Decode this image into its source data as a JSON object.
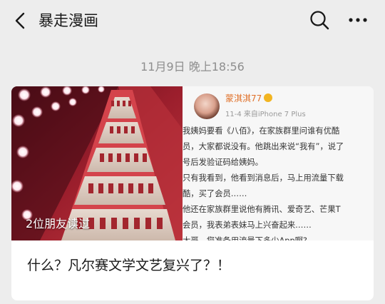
{
  "header": {
    "back_icon": "chevron-left-icon",
    "title": "暴走漫画",
    "search_icon": "search-icon",
    "more_icon": "more-horizontal-icon"
  },
  "timestamp": "11月9日 晚上18:56",
  "article": {
    "friends_read": "2位朋友读过",
    "title": "什么？凡尔赛文学文艺复兴了？！",
    "thumbnail": {
      "left_image": "lipstick-display-counter-photo",
      "post": {
        "username": "蒙淇淇77",
        "meta": "11-4 来自iPhone 7 Plus",
        "lines": [
          "我姨妈要看《八佰》，在家族群里问谁有优酷",
          "员，大家都说没有。他跳出来说“我有”，说了",
          "号后发验证码给姨妈。",
          "只有我看到，他看到消息后，马上用流量下载",
          "酷，买了会员……",
          "他还在家族群里说他有腾讯、爱奇艺、芒果T",
          "会员，我表弟表妹马上兴奋起来……",
          "大哥，您准备用流量下多少App啊?"
        ]
      }
    }
  },
  "colors": {
    "background": "#ededed",
    "card": "#ffffff",
    "timestamp": "#8e8e8e",
    "username": "#e0712a"
  }
}
